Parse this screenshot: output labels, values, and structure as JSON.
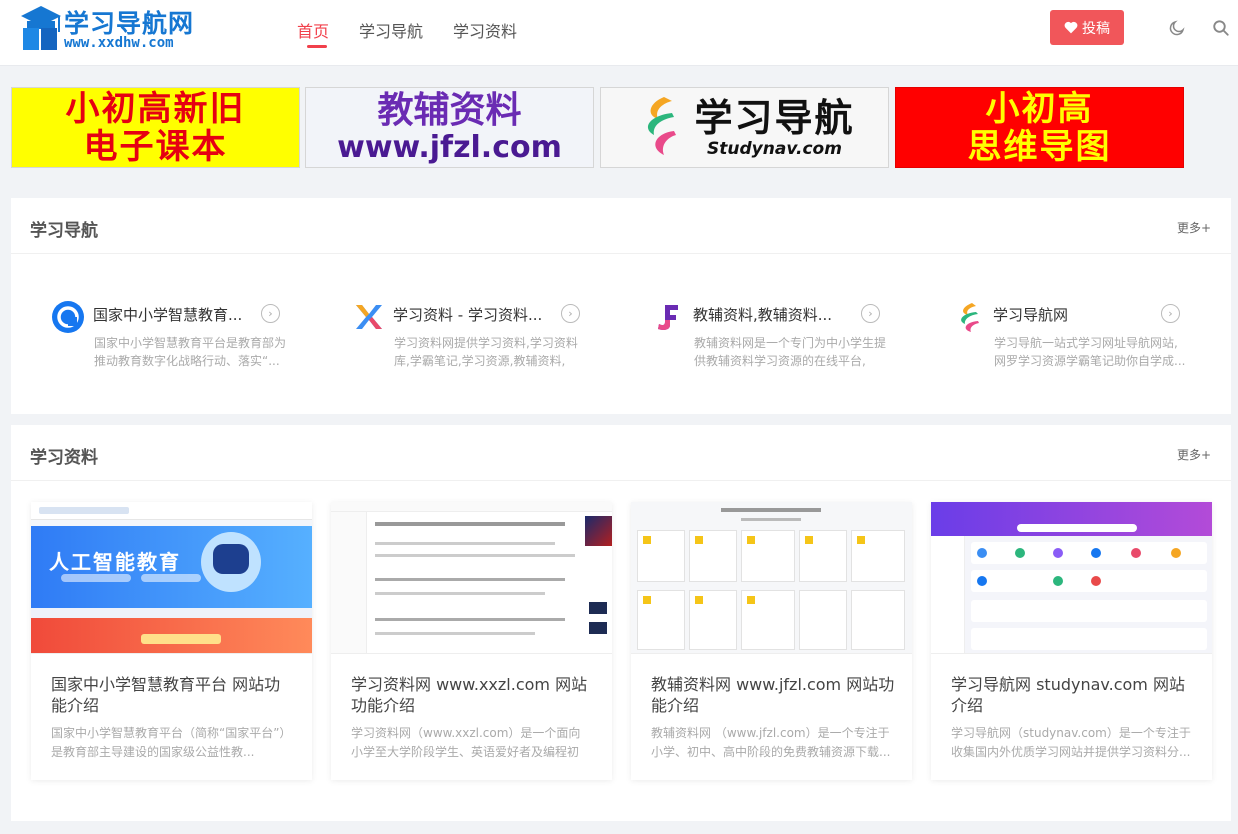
{
  "header": {
    "logo_title": "学习导航网",
    "logo_url": "www.xxdhw.com",
    "nav": [
      {
        "label": "首页"
      },
      {
        "label": "学习导航"
      },
      {
        "label": "学习资料"
      }
    ],
    "submit_label": "投稿",
    "icons": [
      "heart-icon",
      "moon-icon",
      "search-icon"
    ],
    "accent_color": "#f1404b"
  },
  "banners": [
    {
      "line1": "小初高新旧",
      "line2": "电子课本"
    },
    {
      "line1": "教辅资料",
      "line2": "www.jfzl.com"
    },
    {
      "line1": "学习导航",
      "line2": "Studynav.com"
    },
    {
      "line1": "小初高",
      "line2": "思维导图"
    }
  ],
  "nav_section": {
    "title": "学习导航",
    "more": "更多+",
    "sites": [
      {
        "name": "国家中小学智慧教育...",
        "desc": "国家中小学智慧教育平台是教育部为推动教育数字化战略行动、落实“..."
      },
      {
        "name": "学习资料 - 学习资料...",
        "desc": "学习资料网提供学习资料,学习资料库,学霸笔记,学习资源,教辅资料,教..."
      },
      {
        "name": "教辅资料,教辅资料...",
        "desc": "教辅资料网是一个专门为中小学生提供教辅资料学习资源的在线平台,教..."
      },
      {
        "name": "学习导航网",
        "desc": "学习导航一站式学习网址导航网站,网罗学习资源学霸笔记助你自学成..."
      }
    ]
  },
  "res_section": {
    "title": "学习资料",
    "more": "更多+",
    "articles": [
      {
        "title": "国家中小学智慧教育平台 网站功能介绍",
        "desc": "国家中小学智慧教育平台（简称“国家平台”）是教育部主导建设的国家级公益性教...",
        "thumb_text": "人工智能教育"
      },
      {
        "title": "学习资料网 www.xxzl.com 网站功能介绍",
        "desc": "学习资料网（www.xxzl.com）是一个面向小学至大学阶段学生、英语爱好者及编程初学..."
      },
      {
        "title": "教辅资料网 www.jfzl.com 网站功能介绍",
        "desc": "教辅资料网 （www.jfzl.com）是一个专注于小学、初中、高中阶段的免费教辅资源下载..."
      },
      {
        "title": "学习导航网 studynav.com 网站介绍",
        "desc": "学习导航网（studynav.com）是一个专注于收集国内外优质学习网站并提供学习资料分..."
      }
    ]
  }
}
